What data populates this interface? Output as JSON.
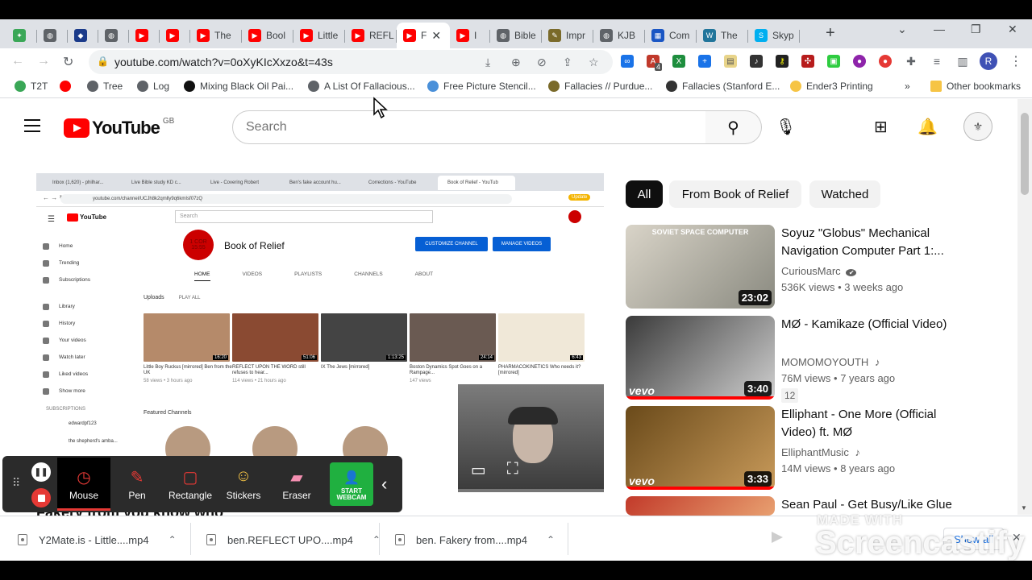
{
  "browser": {
    "tabs": [
      {
        "label": "",
        "color": "#3aa757",
        "icon": "extension-favicon"
      },
      {
        "label": "",
        "color": "#5f6368",
        "icon": "globe-icon"
      },
      {
        "label": "",
        "color": "#1a3a8a",
        "icon": "shield-icon"
      },
      {
        "label": "",
        "color": "#5f6368",
        "icon": "globe-icon"
      },
      {
        "label": "",
        "color": "#ff0000",
        "icon": "youtube-icon"
      },
      {
        "label": "",
        "color": "#ff0000",
        "icon": "youtube-icon"
      },
      {
        "label": "The",
        "color": "#ff0000",
        "icon": "youtube-icon"
      },
      {
        "label": "Bool",
        "color": "#ff0000",
        "icon": "youtube-icon"
      },
      {
        "label": "Little",
        "color": "#ff0000",
        "icon": "youtube-icon"
      },
      {
        "label": "REFL",
        "color": "#ff0000",
        "icon": "youtube-icon"
      },
      {
        "label": "F",
        "color": "#ff0000",
        "icon": "youtube-icon",
        "active": true
      },
      {
        "label": "I",
        "color": "#ff0000",
        "icon": "youtube-icon"
      },
      {
        "label": "Bible",
        "color": "#5f6368",
        "icon": "globe-icon"
      },
      {
        "label": "Impr",
        "color": "#7a6a2a",
        "icon": "pen-icon"
      },
      {
        "label": "KJB",
        "color": "#5f6368",
        "icon": "globe-icon"
      },
      {
        "label": "Com",
        "color": "#1a56c4",
        "icon": "grid-icon"
      },
      {
        "label": "The",
        "color": "#21759b",
        "icon": "wordpress-icon"
      },
      {
        "label": "Skyp",
        "color": "#00aff0",
        "icon": "skype-icon"
      }
    ],
    "url": "youtube.com/watch?v=0oXyKIcXxzo&t=43s",
    "profile_initial": "R",
    "ext_badge": "4",
    "bookmarks": [
      {
        "label": "T2T",
        "color": "#3aa757"
      },
      {
        "label": "",
        "color": "#ff0000"
      },
      {
        "label": "Tree",
        "color": "#5f6368"
      },
      {
        "label": "Log",
        "color": "#5f6368"
      },
      {
        "label": "Mixing Black Oil Pai...",
        "color": "#111"
      },
      {
        "label": "A List Of Fallacious...",
        "color": "#5f6368"
      },
      {
        "label": "Free Picture Stencil...",
        "color": "#4a90d9"
      },
      {
        "label": "Fallacies // Purdue...",
        "color": "#7a6a2a"
      },
      {
        "label": "Fallacies (Stanford E...",
        "color": "#333"
      },
      {
        "label": "Ender3 Printing",
        "color": "#f6c445"
      }
    ],
    "bookmarks_more": "»",
    "other_bookmarks": "Other bookmarks"
  },
  "youtube": {
    "region": "GB",
    "logo_text": "YouTube",
    "search_placeholder": "Search",
    "chips": [
      "All",
      "From Book of Relief",
      "Watched"
    ],
    "below_title": "Fakery from you know who",
    "recommendations": [
      {
        "title": "Soyuz \"Globus\" Mechanical Navigation Computer Part 1:...",
        "channel": "CuriousMarc",
        "verified": true,
        "views": "536K views",
        "age": "3 weeks ago",
        "duration": "23:02",
        "thumb_text": "SOVIET SPACE COMPUTER"
      },
      {
        "title": "MØ - Kamikaze (Official Video)",
        "channel": "MOMOMOYOUTH",
        "music": true,
        "views": "76M views",
        "age": "7 years ago",
        "duration": "3:40",
        "badge": "12",
        "vevo": "vevo"
      },
      {
        "title": "Elliphant - One More (Official Video) ft. MØ",
        "channel": "ElliphantMusic",
        "music": true,
        "views": "14M views",
        "age": "8 years ago",
        "duration": "3:33",
        "vevo": "vevo"
      },
      {
        "title": "Sean Paul - Get Busy/Like Glue",
        "duration": ""
      }
    ]
  },
  "inner_browser": {
    "tabs": [
      "Inbox (1,620) - philhar...",
      "Live Bible study KD c...",
      "Live - Covering Robert",
      "Ben's fake account hu...",
      "Corrections - YouTube",
      "Book of Relief - YouTub"
    ],
    "url": "youtube.com/channel/UCJh8k2qmlly9q6kmIsf07zQ",
    "update": "Update",
    "search": "Search",
    "sidebar": [
      "Home",
      "Trending",
      "Subscriptions",
      "Library",
      "History",
      "Your videos",
      "Watch later",
      "Liked videos",
      "Show more"
    ],
    "subscriptions_label": "SUBSCRIPTIONS",
    "subs": [
      "edwardpf123",
      "the shepherd's amba..."
    ],
    "channel_logo": "1 COR 15:55",
    "channel_name": "Book of Relief",
    "customize": "CUSTOMIZE CHANNEL",
    "manage": "MANAGE VIDEOS",
    "channel_tabs": [
      "HOME",
      "VIDEOS",
      "PLAYLISTS",
      "CHANNELS",
      "ABOUT"
    ],
    "uploads": "Uploads",
    "play_all": "PLAY ALL",
    "videos": [
      {
        "title": "Little Boy Ruckus [mirrored] Ben from the UK",
        "meta": "58 views • 3 hours ago",
        "dur": "16:20"
      },
      {
        "title": "REFLECT UPON THE WORD still refuses to hear...",
        "meta": "114 views • 21 hours ago",
        "dur": "51:06"
      },
      {
        "title": "IX The Jews [mirrored]",
        "meta": "",
        "dur": "1:13:25"
      },
      {
        "title": "Boston Dynamics Spot Goes on a Rampage...",
        "meta": "147 views",
        "dur": "24:14"
      },
      {
        "title": "PHARMACOKINETICS Who needs it? [mirrored]",
        "meta": "",
        "dur": "6:43"
      }
    ],
    "featured": "Featured Channels"
  },
  "recorder": {
    "tools": [
      {
        "label": "Mouse",
        "icon": "mouse-cursor-icon",
        "active": true
      },
      {
        "label": "Pen",
        "icon": "pen-icon"
      },
      {
        "label": "Rectangle",
        "icon": "rectangle-icon"
      },
      {
        "label": "Stickers",
        "icon": "sticker-icon"
      },
      {
        "label": "Eraser",
        "icon": "eraser-icon"
      }
    ],
    "webcam_line1": "START",
    "webcam_line2": "WEBCAM"
  },
  "downloads": {
    "items": [
      "Y2Mate.is - Little....mp4",
      "ben.REFLECT UPO....mp4",
      "ben. Fakery from....mp4"
    ],
    "show_all": "Show all"
  },
  "watermark": {
    "made_with": "MADE WITH",
    "brand": "Screencastify"
  }
}
